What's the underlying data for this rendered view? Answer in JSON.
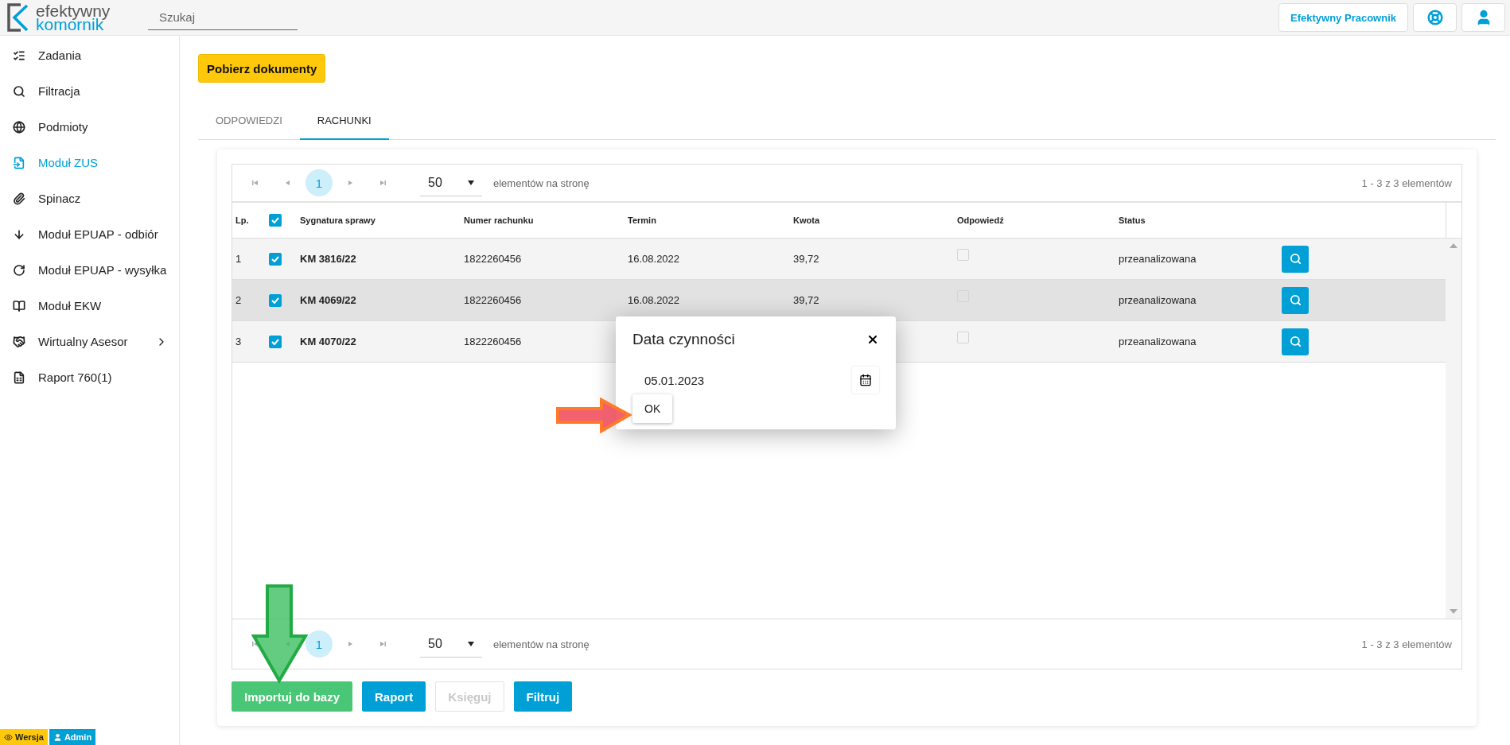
{
  "header": {
    "logo_top": "efektywny",
    "logo_bottom": "komornik",
    "search": {
      "placeholder": "Szukaj"
    },
    "user_button": "Efektywny Pracownik"
  },
  "sidebar": {
    "items": [
      {
        "label": "Zadania",
        "selected": false,
        "expandable": false
      },
      {
        "label": "Filtracja",
        "selected": false,
        "expandable": false
      },
      {
        "label": "Podmioty",
        "selected": false,
        "expandable": false
      },
      {
        "label": "Moduł ZUS",
        "selected": true,
        "expandable": false
      },
      {
        "label": "Spinacz",
        "selected": false,
        "expandable": false
      },
      {
        "label": "Moduł EPUAP - odbiór",
        "selected": false,
        "expandable": false
      },
      {
        "label": "Moduł EPUAP - wysyłka",
        "selected": false,
        "expandable": false
      },
      {
        "label": "Moduł EKW",
        "selected": false,
        "expandable": false
      },
      {
        "label": "Wirtualny Asesor",
        "selected": false,
        "expandable": true
      },
      {
        "label": "Raport 760(1)",
        "selected": false,
        "expandable": false
      }
    ]
  },
  "download_button": "Pobierz dokumenty",
  "tabs": [
    {
      "label": "ODPOWIEDZI",
      "selected": false
    },
    {
      "label": "RACHUNKI",
      "selected": true
    }
  ],
  "pagers": [
    {
      "pages": [
        {
          "label": "1",
          "selected": true
        }
      ],
      "page_size": "50",
      "page_size_label": "elementów na stronę",
      "summary": "1 - 3 z 3 elementów"
    },
    {
      "pages": [
        {
          "label": "1",
          "selected": true
        }
      ],
      "page_size": "50",
      "page_size_label": "elementów na stronę",
      "summary": "1 - 3 z 3 elementów"
    }
  ],
  "table": {
    "columns": {
      "lp": "Lp.",
      "signature": "Sygnatura sprawy",
      "account": "Numer rachunku",
      "deadline": "Termin",
      "amount": "Kwota",
      "answer": "Odpowiedź",
      "status": "Status"
    },
    "all_checked": true,
    "rows": [
      {
        "lp": "1",
        "checked": true,
        "signature": "KM 3816/22",
        "account": "1822260456",
        "deadline": "16.08.2022",
        "amount": "39,72",
        "answered": false,
        "status": "przeanalizowana",
        "highlighted": false
      },
      {
        "lp": "2",
        "checked": true,
        "signature": "KM 4069/22",
        "account": "1822260456",
        "deadline": "16.08.2022",
        "amount": "39,72",
        "answered": false,
        "status": "przeanalizowana",
        "highlighted": true
      },
      {
        "lp": "3",
        "checked": true,
        "signature": "KM 4070/22",
        "account": "1822260456",
        "answered": false,
        "status": "przeanalizowana",
        "highlighted": false
      }
    ]
  },
  "footer_buttons": [
    {
      "label": "Importuj do bazy",
      "kind": "success",
      "disabled": false
    },
    {
      "label": "Raport",
      "kind": "primary",
      "disabled": false
    },
    {
      "label": "Księguj",
      "kind": "primary",
      "disabled": true
    },
    {
      "label": "Filtruj",
      "kind": "primary",
      "disabled": false
    }
  ],
  "dialog": {
    "title": "Data czynności",
    "date": "05.01.2023",
    "ok": "OK"
  },
  "badges": [
    {
      "label": "Wersja",
      "kind": "version"
    },
    {
      "label": "Admin",
      "kind": "user"
    }
  ]
}
